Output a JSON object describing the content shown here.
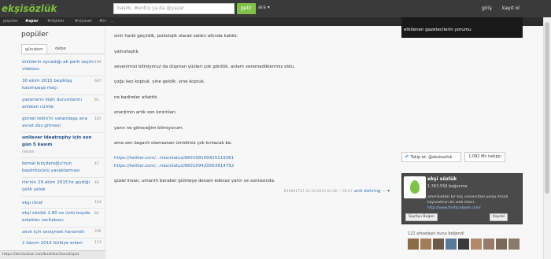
{
  "header": {
    "logo": "ekşisözlük",
    "search_placeholder": "başlık, #entry ya da @yazar",
    "search_button": "getir",
    "ara_label": "ara ▾",
    "login": "giriş",
    "register": "kayıt ol"
  },
  "nav": [
    "popüler",
    "#spor",
    "#ilişkiler",
    "#siyaset",
    "#tv",
    "..."
  ],
  "sidebar": {
    "title": "popüler",
    "tabs": [
      "gündem",
      "debe"
    ],
    "topics": [
      {
        "text": "ünlülerin oynadığı ak parti seçim videosu",
        "count": "199"
      },
      {
        "text": "30 ekim 2015 beşiktaş kasımpaşa maçı",
        "count": "607"
      },
      {
        "text": "yazarların ilişki durumlarını anlatan cümle",
        "count": "91"
      },
      {
        "text": "gürsel tekin'in vatandaşa ana avrat düz gitmesi",
        "count": "187"
      },
      {
        "text": "unilever ideatrophy için son gün 5 kasım",
        "sub": "reklam",
        "count": ""
      },
      {
        "text": "kemal kılıçdaroğlu'nun başörtüsünü yasaklatması",
        "count": "47"
      },
      {
        "text": "rte'nin 29 ekim 2015'te giydiği çelik yelek",
        "count": "40"
      },
      {
        "text": "ekşi itiraf",
        "count": "124"
      },
      {
        "text": "ekşi sözlük 1.80 ve üstü boyda erkekler veritabanı",
        "count": "64"
      },
      {
        "text": "zevk için sevişmek haramdır",
        "count": "205"
      },
      {
        "text": "1 kasım 2015 türkiye erken",
        "count": "113"
      }
    ]
  },
  "content": {
    "lines": [
      "sinir harbi geçirdik, psikolojik olarak saldırı altında kaldık.",
      "yalnızlaştık.",
      "sevenimizi bilmiyoruz da düşman yüzleri çok gördük. anlam veremediklerimiz oldu.",
      "çoğu kez koptuk. yine geldik. yine koptuk.",
      "ne badireler atlattık.",
      "enerjimin artık son kırıntıları.",
      "yarın ne göreceğim bilmiyorum.",
      "ama sen başarılı olamazsan ümidimiz çok kırılacak be."
    ],
    "links": [
      "https://twitter.com/...rtas/status/660158100415119361",
      "https://twitter.com/...rtas/status/660159420563914752"
    ],
    "closing": "güzel insan, umarım beraber gülmeye devam edecez yarın ve sonrasında.",
    "meta": "#55901727 31.10.2015 02:46 ~ 02:47",
    "author": "anti duhring ··· ▾"
  },
  "right": {
    "top_block": "etkilenen gazetecilerin yorumu",
    "twitter_follow": "Takip et: @eksisozluk",
    "followers": "1.092 Mn takipçi",
    "fb_name": "ekşi sözlük",
    "fb_likes": "1.363.556 beğenme",
    "fb_post": "amerikadaki bir kaç universitesi yonja misali kaynastiran bir web sitesi.",
    "fb_link": "http://www.thefacebook.com/",
    "fb_like_btn": "Sayfayı Beğen",
    "fb_share_btn": "Kaydol",
    "fb_friends": "122 arkadaşın bunu beğendi"
  },
  "status_url": "https://eksisozluk.com/basliklar/kanal/spor",
  "colors": {
    "accent": "#81c14b",
    "link": "#2e6db4",
    "header": "#3a3a3a"
  }
}
